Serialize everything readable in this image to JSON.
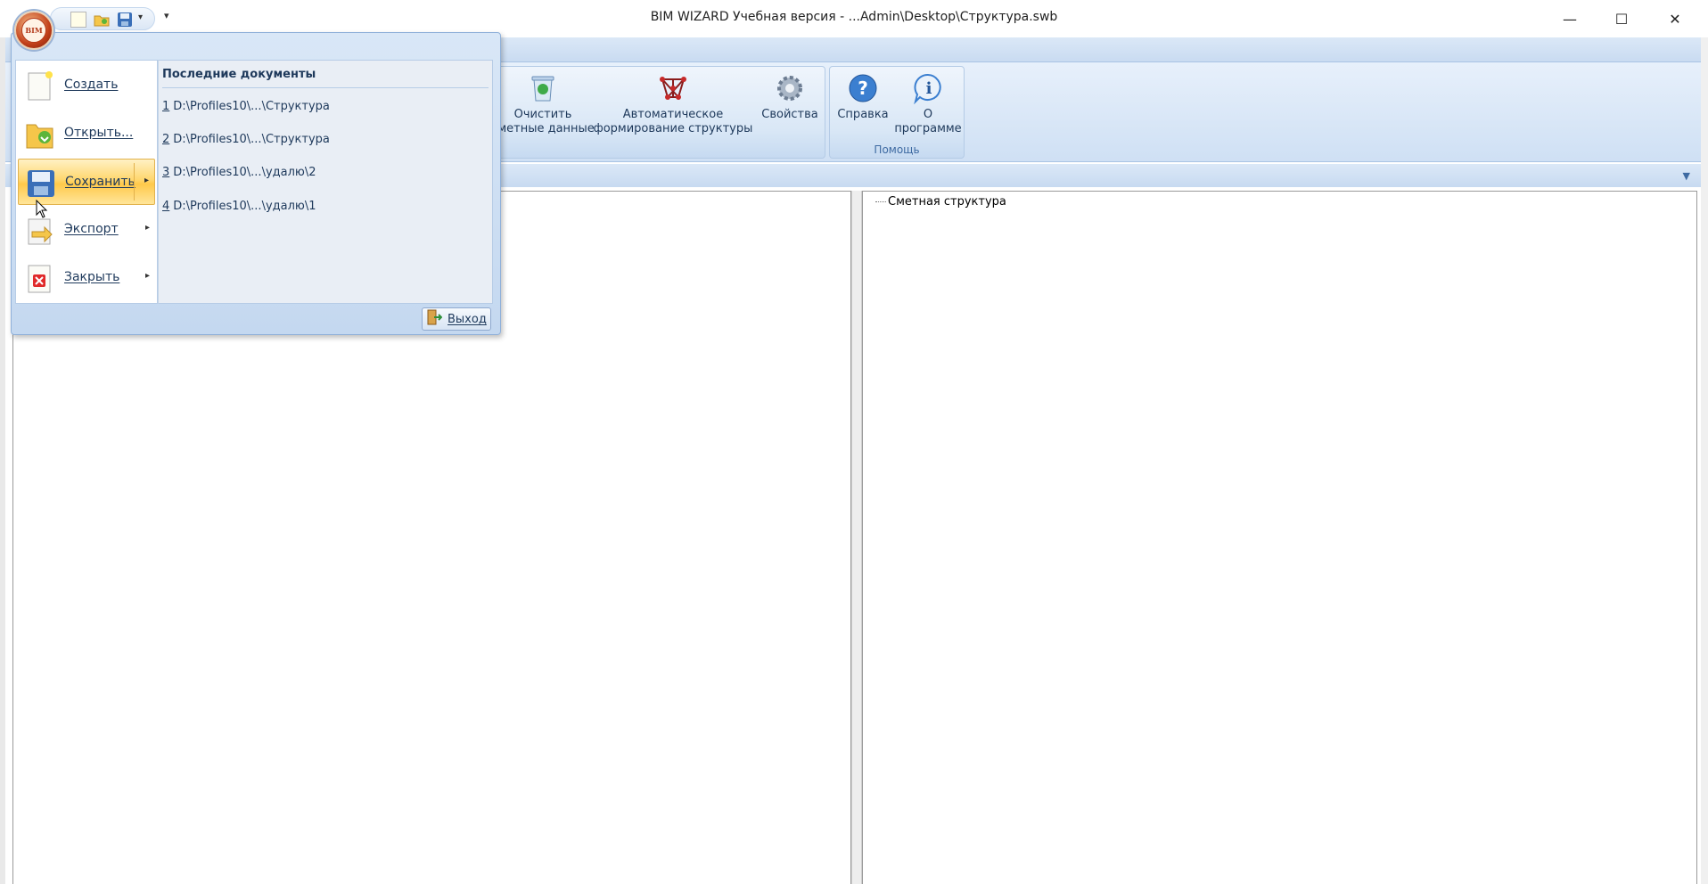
{
  "window": {
    "title": "BIM WIZARD  Учебная версия - ...Admin\\Desktop\\Структура.swb",
    "minimize": "—",
    "maximize": "☐",
    "close": "✕"
  },
  "orb": {
    "text": "BIM"
  },
  "quick_access": {
    "dropdown_glyph": "▾",
    "customize_glyph": "▾"
  },
  "ribbon": {
    "buttons": [
      {
        "label_1": "Очистить",
        "label_2": "сметные данные",
        "icon": "recycle-bin-icon"
      },
      {
        "label_1": "Автоматическое",
        "label_2": "формирование структуры",
        "icon": "structure-icon"
      },
      {
        "label_1": "Свойства",
        "label_2": "",
        "icon": "gear-icon"
      },
      {
        "label_1": "Справка",
        "label_2": "",
        "icon": "help-icon"
      },
      {
        "label_1": "О",
        "label_2": "программе",
        "icon": "info-icon"
      }
    ],
    "group_help": "Помощь",
    "collapse_glyph": "▼"
  },
  "app_menu": {
    "items": [
      {
        "label": "Создать",
        "has_submenu": false
      },
      {
        "label": "Открыть...",
        "has_submenu": false
      },
      {
        "label": "Сохранить",
        "has_submenu": true
      },
      {
        "label": "Экспорт",
        "has_submenu": true
      },
      {
        "label": "Закрыть",
        "has_submenu": true
      }
    ],
    "submenu_glyph": "▸",
    "recent_title": "Последние документы",
    "recent": [
      {
        "num": "1",
        "path": "D:\\Profiles10\\...\\Структура"
      },
      {
        "num": "2",
        "path": "D:\\Profiles10\\...\\Структура"
      },
      {
        "num": "3",
        "path": "D:\\Profiles10\\...\\удалю\\2"
      },
      {
        "num": "4",
        "path": "D:\\Profiles10\\...\\удалю\\1"
      }
    ],
    "exit_label": "Выход"
  },
  "tree": {
    "root": "Сметная структура"
  },
  "colors": {
    "accent": "#1e395b",
    "ribbon": "#cfe0f4",
    "highlight": "#ffd76f"
  }
}
